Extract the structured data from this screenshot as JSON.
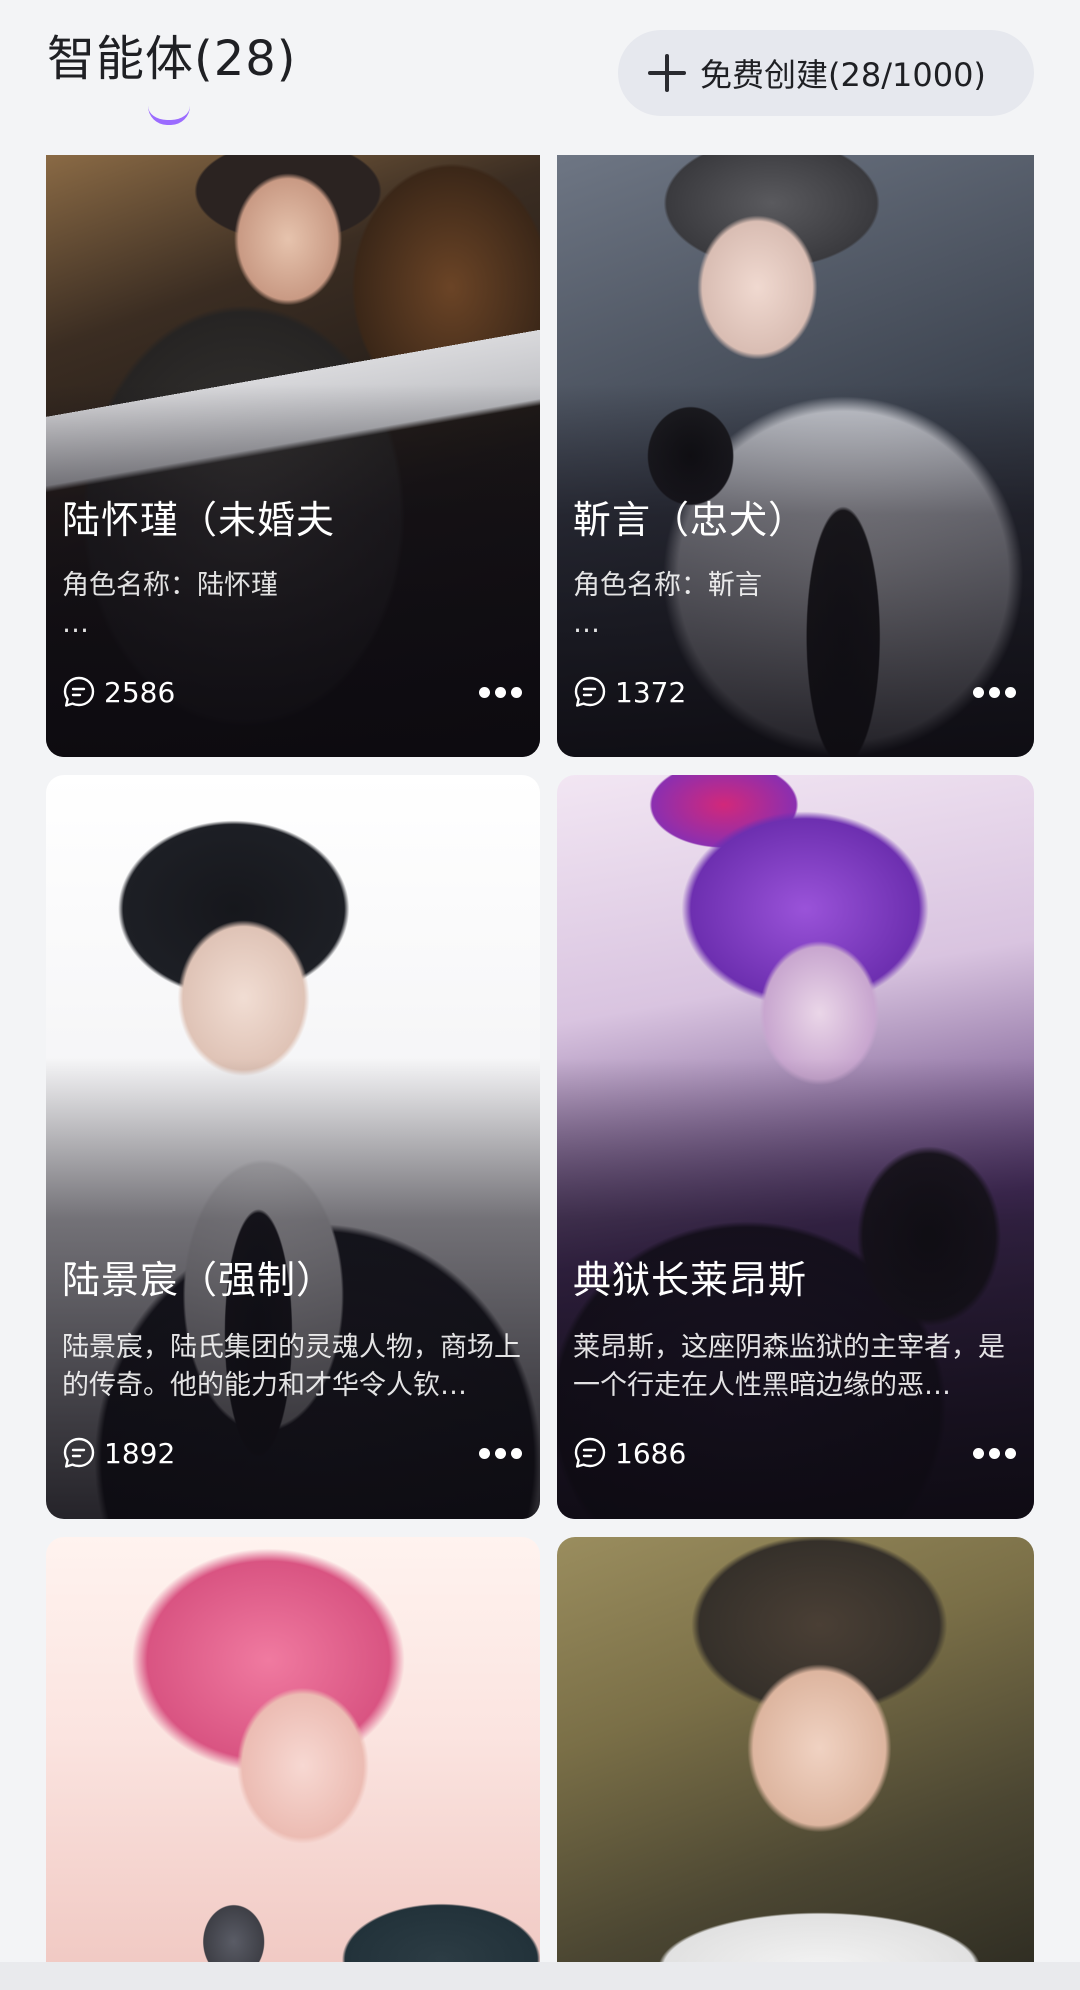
{
  "header": {
    "title": "智能体(28)",
    "create_button_label": "免费创建(28/1000)"
  },
  "colors": {
    "accent_underline": "#9b6bff",
    "page_background": "#f3f4f6",
    "create_button_background": "#e6e8ee"
  },
  "cards": [
    {
      "name": "陆怀瑾（未婚夫",
      "description": "角色名称：陆怀瑾\n…",
      "chat_count": "2586",
      "icons": [
        "chat-bubble-icon",
        "more-icon"
      ]
    },
    {
      "name": "靳言（忠犬）",
      "description": "角色名称：靳言\n…",
      "chat_count": "1372",
      "icons": [
        "chat-bubble-icon",
        "more-icon"
      ]
    },
    {
      "name": "陆景宸（强制）",
      "description": "陆景宸，陆氏集团的灵魂人物，商场上的传奇。他的能力和才华令人钦…",
      "chat_count": "1892",
      "icons": [
        "chat-bubble-icon",
        "more-icon"
      ]
    },
    {
      "name": "典狱长莱昂斯",
      "description": "莱昂斯，这座阴森监狱的主宰者，是一个行走在人性黑暗边缘的恶…",
      "chat_count": "1686",
      "icons": [
        "chat-bubble-icon",
        "more-icon"
      ]
    },
    {
      "name": "",
      "description": "",
      "chat_count": ""
    },
    {
      "name": "",
      "description": "",
      "chat_count": ""
    }
  ]
}
